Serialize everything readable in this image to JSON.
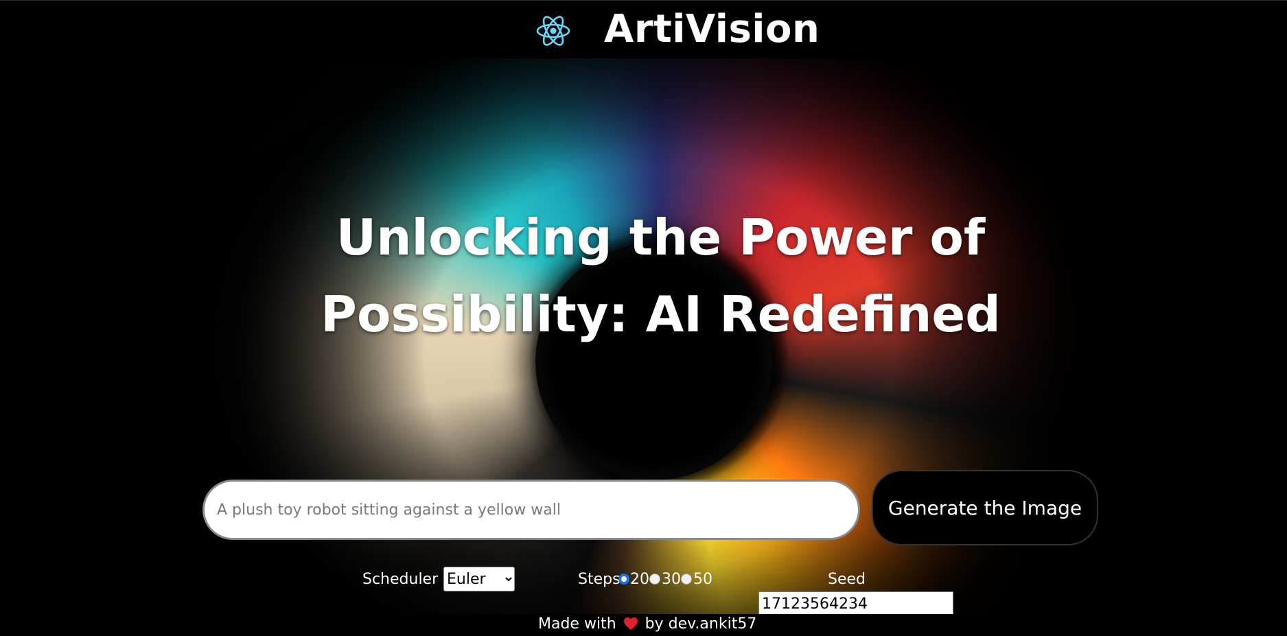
{
  "navbar": {
    "title": "ArtiVision",
    "logo_icon": "react-atom-icon"
  },
  "hero": {
    "headline": "Unlocking the Power of Possibility: AI Redefined"
  },
  "prompt": {
    "placeholder": "A plush toy robot sitting against a yellow wall",
    "value": ""
  },
  "generate_button": {
    "label": "Generate the Image"
  },
  "options": {
    "scheduler": {
      "label": "Scheduler",
      "selected": "Euler"
    },
    "steps": {
      "label": "Steps",
      "choices": [
        "20",
        "30",
        "50"
      ],
      "selected": "20"
    },
    "seed": {
      "label": "Seed",
      "value": "17123564234"
    }
  },
  "footer": {
    "prefix": "Made with",
    "suffix": "by dev.ankit57",
    "heart_icon": "heart-icon",
    "heart_color": "#e0202a"
  },
  "colors": {
    "accent": "#61dafb",
    "radio_accent": "#1a73e8",
    "background": "#000000"
  }
}
